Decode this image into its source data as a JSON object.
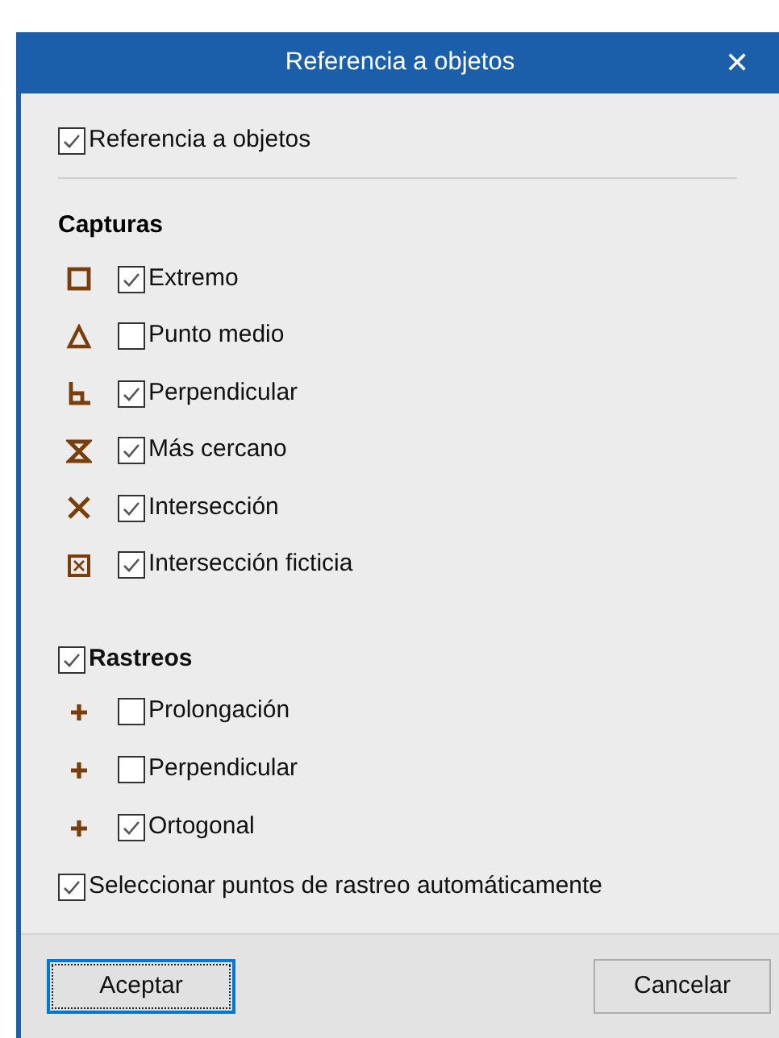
{
  "window": {
    "title": "Referencia a objetos",
    "close": "✕"
  },
  "master": {
    "label": "Referencia a objetos",
    "checked": true
  },
  "snaps": {
    "heading": "Capturas",
    "items": [
      {
        "kind": "square",
        "label": "Extremo",
        "checked": true
      },
      {
        "kind": "triangle",
        "label": "Punto medio",
        "checked": false
      },
      {
        "kind": "perpendicular",
        "label": "Perpendicular",
        "checked": true
      },
      {
        "kind": "hourglass",
        "label": "Más cercano",
        "checked": true
      },
      {
        "kind": "cross",
        "label": "Intersección",
        "checked": true
      },
      {
        "kind": "boxed-cross",
        "label": "Intersección ficticia",
        "checked": true
      }
    ]
  },
  "tracking": {
    "label": "Rastreos",
    "checked": true,
    "items": [
      {
        "kind": "plus",
        "label": "Prolongación",
        "checked": false
      },
      {
        "kind": "plus",
        "label": "Perpendicular",
        "checked": false
      },
      {
        "kind": "plus",
        "label": "Ortogonal",
        "checked": true
      }
    ]
  },
  "auto_select": {
    "label": "Seleccionar puntos de rastreo automáticamente",
    "checked": true
  },
  "buttons": [
    {
      "label": "Aceptar",
      "focused": true
    },
    {
      "label": "Cancelar",
      "focused": false
    }
  ]
}
